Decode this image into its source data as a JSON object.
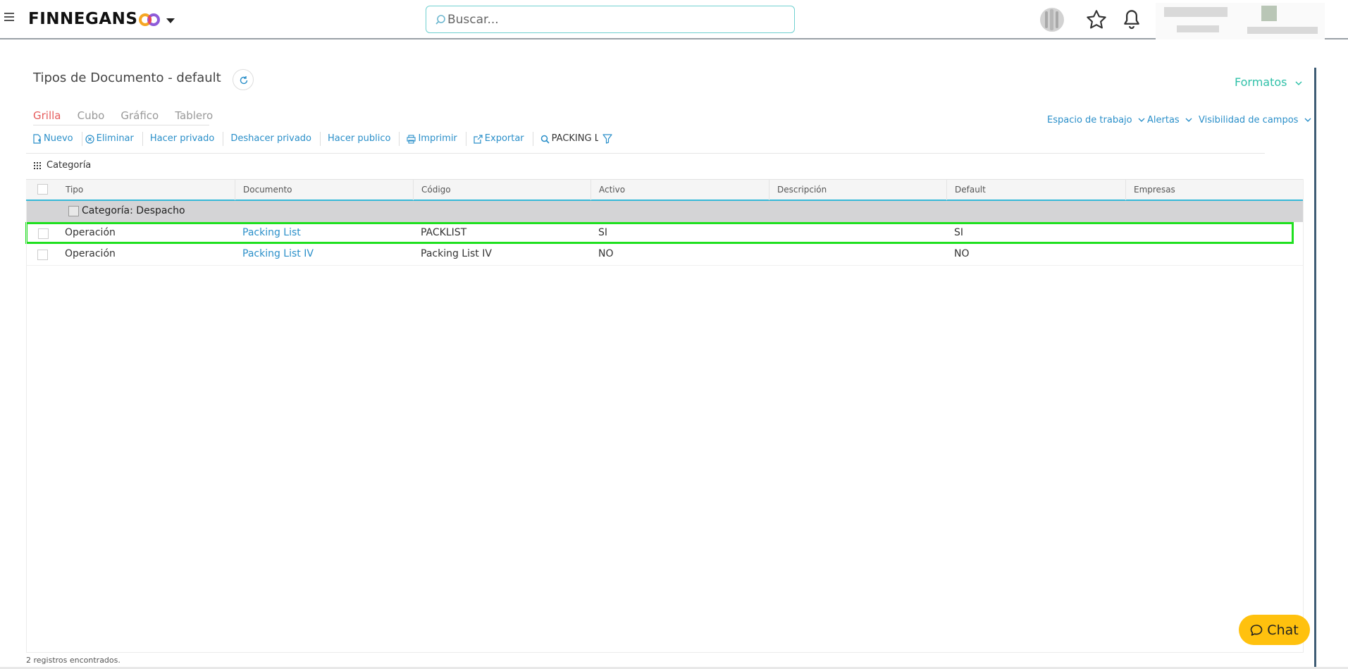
{
  "app": {
    "brand": "FINNEGANS",
    "search_placeholder": "Buscar..."
  },
  "page": {
    "title": "Tipos de Documento - default",
    "formatos_label": "Formatos"
  },
  "view_tabs": [
    {
      "label": "Grilla",
      "active": true
    },
    {
      "label": "Cubo",
      "active": false
    },
    {
      "label": "Gráfico",
      "active": false
    },
    {
      "label": "Tablero",
      "active": false
    }
  ],
  "workspace_menus": {
    "workspace": "Espacio de trabajo",
    "alerts": "Alertas",
    "visibility": "Visibilidad de campos"
  },
  "toolbar": {
    "nuevo": "Nuevo",
    "eliminar": "Eliminar",
    "hacer_privado": "Hacer privado",
    "deshacer_privado": "Deshacer privado",
    "hacer_publico": "Hacer publico",
    "imprimir": "Imprimir",
    "exportar": "Exportar",
    "filter_text": "PACKING L"
  },
  "group_by_label": "Categoría",
  "grid": {
    "columns": [
      "Tipo",
      "Documento",
      "Código",
      "Activo",
      "Descripción",
      "Default",
      "Empresas"
    ],
    "group": "Categoría: Despacho",
    "rows": [
      {
        "tipo": "Operación",
        "documento": "Packing List",
        "codigo": "PACKLIST",
        "activo": "SI",
        "descripcion": "",
        "default": "SI",
        "empresas": "",
        "selected": true
      },
      {
        "tipo": "Operación",
        "documento": "Packing List IV",
        "codigo": "Packing List IV",
        "activo": "NO",
        "descripcion": "",
        "default": "NO",
        "empresas": "",
        "selected": false
      }
    ]
  },
  "footer": {
    "count_text": "2 registros encontrados."
  },
  "chat_label": "Chat",
  "colors": {
    "accent_link": "#2a8fc9",
    "accent_teal": "#2fc0a8",
    "active_tab": "#e65c5c",
    "chat_bg": "#ffc10e",
    "selection": "#1fe01f"
  }
}
